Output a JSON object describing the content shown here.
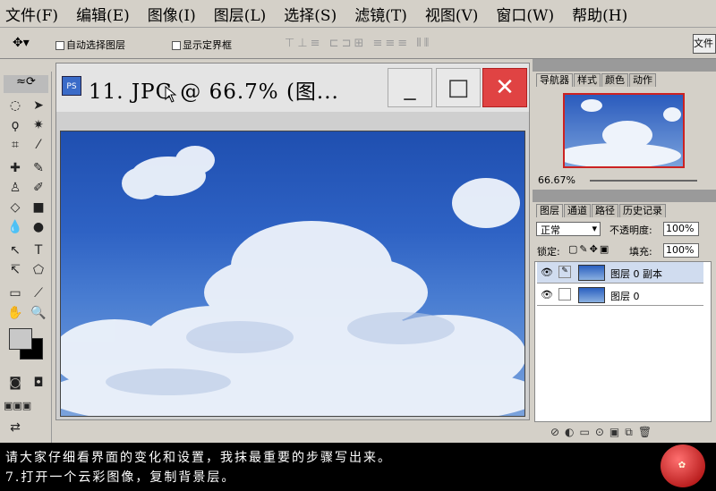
{
  "menu": [
    "文件(F)",
    "编辑(E)",
    "图像(I)",
    "图层(L)",
    "选择(S)",
    "滤镜(T)",
    "视图(V)",
    "窗口(W)",
    "帮助(H)"
  ],
  "options": {
    "auto_select": "自动选择图层",
    "show_bounds": "显示定界框",
    "right_field": "文件"
  },
  "document": {
    "title": "11. JPG @ 66.7% (图..."
  },
  "navigator": {
    "tabs": [
      "导航器",
      "样式",
      "颜色",
      "动作"
    ],
    "zoom": "66.67%"
  },
  "layers_panel": {
    "tabs": [
      "图层",
      "通道",
      "路径",
      "历史记录"
    ],
    "blend_mode": "正常",
    "opacity_label": "不透明度:",
    "opacity_value": "100%",
    "lock_label": "锁定:",
    "fill_label": "填充:",
    "fill_value": "100%",
    "layers": [
      {
        "name": "图层 0 副本"
      },
      {
        "name": "图层 0"
      }
    ]
  },
  "instructions": [
    "请大家仔细看界面的变化和设置，我抹最重要的步骤写出来。",
    "7.打开一个云彩图像，复制背景层。"
  ],
  "colors": {
    "close": "#e04343",
    "sky": "#2e62c4",
    "selected_layer": "#d0dcef"
  }
}
